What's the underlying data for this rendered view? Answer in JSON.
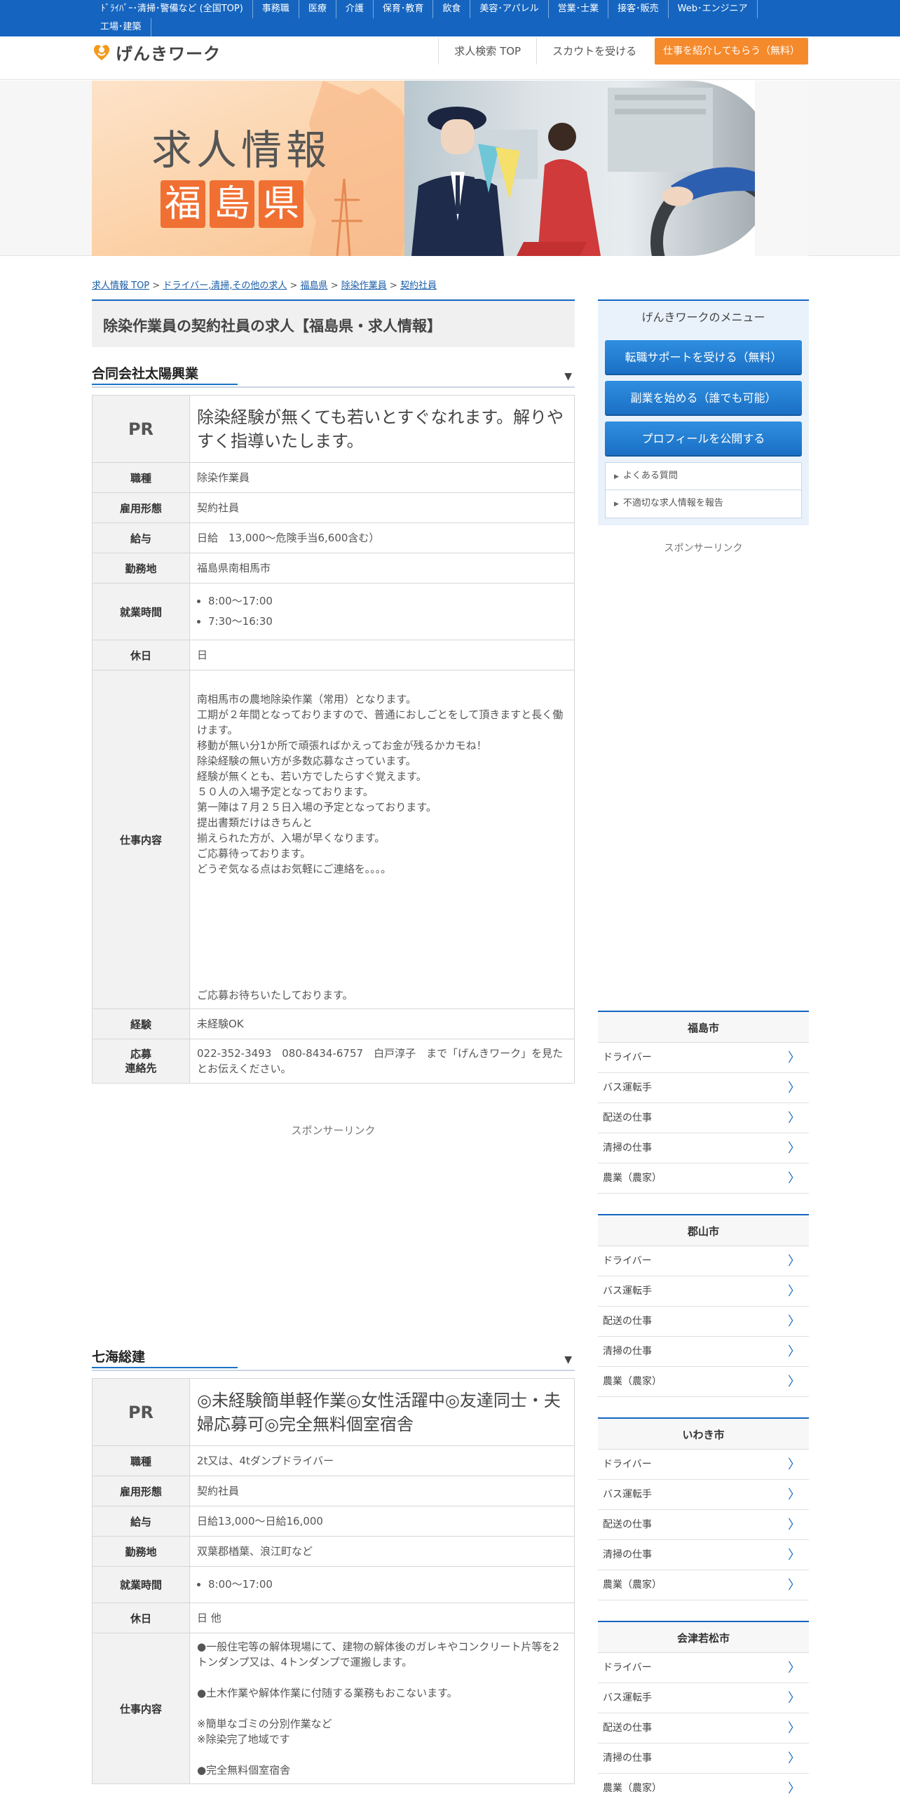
{
  "top_nav": {
    "items": [
      "ﾄﾞﾗｲﾊﾞｰ･清掃･警備など (全国TOP)",
      "事務職",
      "医療",
      "介護",
      "保育･教育",
      "飲食",
      "美容･アパレル",
      "営業･士業",
      "接客･販売",
      "Web･エンジニア",
      "工場･建築"
    ]
  },
  "header": {
    "logo_text": "げんきワーク",
    "links": [
      "求人検索 TOP",
      "スカウトを受ける"
    ],
    "cta": "仕事を紹介してもらう（無料）"
  },
  "hero": {
    "title": "求人情報",
    "prefecture_chars": [
      "福",
      "島",
      "県"
    ]
  },
  "breadcrumb": {
    "items": [
      "求人情報 TOP",
      "ドライバー,清掃,その他の求人",
      "福島県",
      "除染作業員",
      "契約社員"
    ],
    "separator": ">"
  },
  "page_title": "除染作業員の契約社員の求人【福島県・求人情報】",
  "labels": {
    "pr": "PR",
    "job_type": "職種",
    "employment": "雇用形態",
    "salary": "給与",
    "location": "勤務地",
    "hours": "就業時間",
    "holiday": "休日",
    "description": "仕事内容",
    "experience": "経験",
    "contact": "応募\n連絡先",
    "toggle_icon": "▼"
  },
  "listings": [
    {
      "company": "合同会社太陽興業",
      "pr": "除染経験が無くても若いとすぐなれます。解りやすく指導いたします。",
      "job_type": "除染作業員",
      "employment": "契約社員",
      "salary": "日給　13,000〜危険手当6,600含む）",
      "location": "福島県南相馬市",
      "hours": [
        "8:00〜17:00",
        "7:30〜16:30"
      ],
      "holiday": "日",
      "description": "南相馬市の農地除染作業（常用）となります。\n工期が２年間となっておりますので、普通におしごとをして頂きますと長く働けます。\n移動が無い分1か所で頑張ればかえってお金が残るかカモね！\n除染経験の無い方が多数応募なさっています。\n経験が無くとも、若い方でしたらすぐ覚えます。\n５０人の入場予定となっております。\n第一陣は７月２５日入場の予定となっております。\n提出書類だけはきちんと\n揃えられた方が、入場が早くなります。\nご応募待っております。\nどうぞ気なる点はお気軽にご連絡を。。。。",
      "description_closing": "ご応募お待ちいたしております。",
      "experience": "未経験OK",
      "contact": "022-352-3493　080-8434-6757　白戸淳子　まで「げんきワーク」を見たとお伝えください。"
    },
    {
      "company": "七海総建",
      "pr": "◎未経験簡単軽作業◎女性活躍中◎友達同士・夫婦応募可◎完全無料個室宿舎",
      "job_type": "2t又は、4tダンプドライバー",
      "employment": "契約社員",
      "salary": "日給13,000～日給16,000",
      "location": "双葉郡楢葉、浪江町など",
      "hours": [
        "8:00〜17:00"
      ],
      "holiday": "日 他",
      "description": "●一般住宅等の解体現場にて、建物の解体後のガレキやコンクリート片等を2トンダンプ又は、4トンダンプで運搬します。\n\n●土木作業や解体作業に付随する業務もおこないます。\n\n※簡単なゴミの分別作業など\n※除染完了地域です\n\n●完全無料個室宿舎"
    }
  ],
  "sponsor_label": "スポンサーリンク",
  "sidebar": {
    "menu_title": "げんきワークのメニュー",
    "buttons": [
      "転職サポートを受ける（無料）",
      "副業を始める（誰でも可能）",
      "プロフィールを公開する"
    ],
    "links": [
      "よくある質問",
      "不適切な求人情報を報告"
    ],
    "sponsor_label": "スポンサーリンク"
  },
  "city_sections": [
    {
      "city": "福島市",
      "items": [
        "ドライバー",
        "バス運転手",
        "配送の仕事",
        "清掃の仕事",
        "農業（農家）"
      ]
    },
    {
      "city": "郡山市",
      "items": [
        "ドライバー",
        "バス運転手",
        "配送の仕事",
        "清掃の仕事",
        "農業（農家）"
      ]
    },
    {
      "city": "いわき市",
      "items": [
        "ドライバー",
        "バス運転手",
        "配送の仕事",
        "清掃の仕事",
        "農業（農家）"
      ]
    },
    {
      "city": "会津若松市",
      "items": [
        "ドライバー",
        "バス運転手",
        "配送の仕事",
        "清掃の仕事",
        "農業（農家）"
      ]
    }
  ],
  "colors": {
    "brand_blue": "#1565c0",
    "cta_orange": "#f58a2c",
    "pref_orange": "#f07033"
  }
}
